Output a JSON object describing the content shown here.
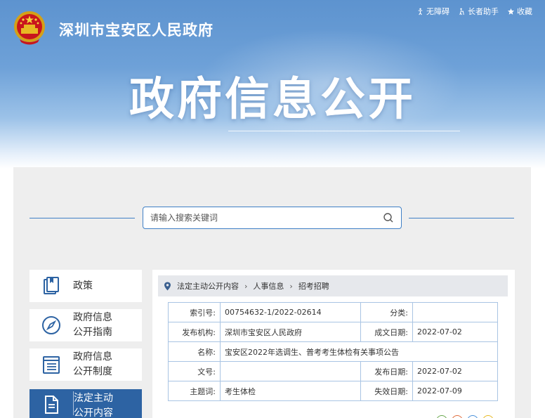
{
  "header": {
    "site_name": "深圳市宝安区人民政府",
    "big_title": "政府信息公开",
    "links": [
      {
        "label": "无障碍",
        "icon": "accessibility-icon"
      },
      {
        "label": "长者助手",
        "icon": "elder-assist-icon"
      },
      {
        "label": "收藏",
        "icon": "favorite-icon"
      }
    ]
  },
  "search": {
    "placeholder": "请输入搜索关键词"
  },
  "nav": [
    {
      "label": "政策",
      "icon": "book-icon",
      "active": false
    },
    {
      "label": "政府信息\n公开指南",
      "icon": "compass-icon",
      "active": false
    },
    {
      "label": "政府信息\n公开制度",
      "icon": "document-list-icon",
      "active": false
    },
    {
      "label": "法定主动\n公开内容",
      "icon": "file-icon",
      "active": true
    }
  ],
  "breadcrumb": [
    "法定主动公开内容",
    "人事信息",
    "招考招聘"
  ],
  "meta": {
    "index_no_label": "索引号:",
    "index_no": "00754632-1/2022-02614",
    "category_label": "分类:",
    "category": "",
    "publisher_label": "发布机构:",
    "publisher": "深圳市宝安区人民政府",
    "created_label": "成文日期:",
    "created": "2022-07-02",
    "name_label": "名称:",
    "name": "宝安区2022年选调生、普考考生体检有关事项公告",
    "doc_no_label": "文号:",
    "doc_no": "",
    "publish_label": "发布日期:",
    "publish": "2022-07-02",
    "subject_label": "主题词:",
    "subject": "考生体检",
    "expire_label": "失效日期:",
    "expire": "2022-07-09"
  },
  "colors": {
    "brand_blue": "#2d63a3",
    "line_blue": "#3f7fc6",
    "table_border": "#a9c4e3"
  }
}
